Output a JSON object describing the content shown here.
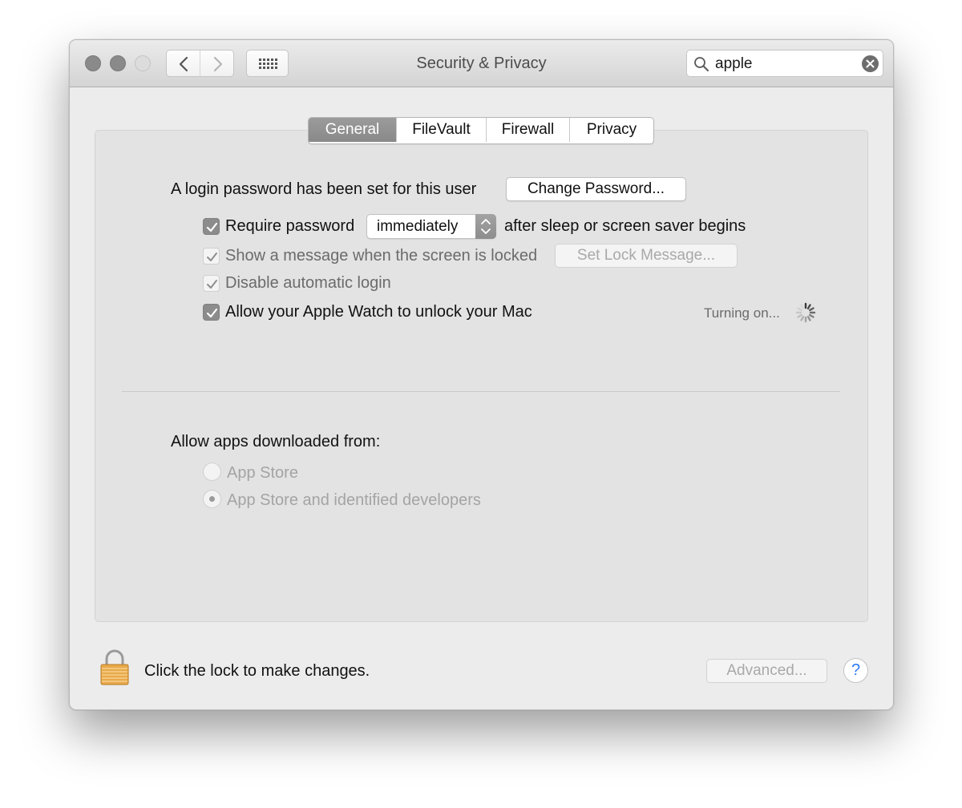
{
  "window": {
    "title": "Security & Privacy"
  },
  "toolbar": {
    "back_icon": "chevron-left-icon",
    "forward_icon": "chevron-right-icon",
    "grid_icon": "grid-icon"
  },
  "search": {
    "value": "apple",
    "icon": "search-icon",
    "clear_icon": "clear-icon"
  },
  "tabs": [
    {
      "label": "General",
      "active": true
    },
    {
      "label": "FileVault",
      "active": false
    },
    {
      "label": "Firewall",
      "active": false
    },
    {
      "label": "Privacy",
      "active": false
    }
  ],
  "general": {
    "login_password_text": "A login password has been set for this user",
    "change_password_label": "Change Password...",
    "require_password": {
      "label": "Require password",
      "checked": true,
      "select_value": "immediately",
      "suffix": "after sleep or screen saver begins"
    },
    "show_message": {
      "label": "Show a message when the screen is locked",
      "checked": true,
      "button_label": "Set Lock Message..."
    },
    "disable_auto_login": {
      "label": "Disable automatic login",
      "checked": true
    },
    "apple_watch": {
      "label": "Allow your Apple Watch to unlock your Mac",
      "checked": true,
      "status": "Turning on..."
    }
  },
  "downloads": {
    "heading": "Allow apps downloaded from:",
    "options": [
      {
        "label": "App Store",
        "selected": false
      },
      {
        "label": "App Store and identified developers",
        "selected": true
      }
    ]
  },
  "footer": {
    "lock_text": "Click the lock to make changes.",
    "advanced_label": "Advanced...",
    "help_label": "?"
  },
  "colors": {
    "window_bg": "#ececec",
    "panel_bg": "#e3e3e3",
    "active_tab": "#8f8f8f",
    "help_blue": "#2f7bf5",
    "lock_gold": "#e9a94a"
  }
}
